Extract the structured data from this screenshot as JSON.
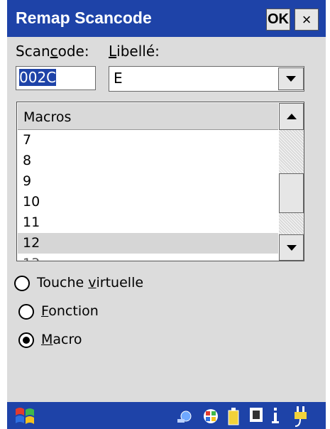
{
  "window": {
    "title": "Remap Scancode",
    "ok_label": "OK",
    "close_label": "×"
  },
  "fields": {
    "scancode_label_before": "Scan",
    "scancode_label_u": "c",
    "scancode_label_after": "ode:",
    "label_label_u": "L",
    "label_label_after": "ibellé:",
    "scancode_value": "002C",
    "label_value": "E"
  },
  "list": {
    "header": "Macros",
    "items": [
      "7",
      "8",
      "9",
      "10",
      "11",
      "12"
    ],
    "selected_value": "12"
  },
  "options": {
    "virtual_key_before": "Touche ",
    "virtual_key_u": "v",
    "virtual_key_after": "irtuelle",
    "function_u": "F",
    "function_after": "onction",
    "macro_u": "M",
    "macro_after": "acro",
    "selected": "macro"
  },
  "colors": {
    "titlebar": "#1e43a8",
    "dialog_bg": "#dcdcdc",
    "selection": "#d6d6d6"
  }
}
